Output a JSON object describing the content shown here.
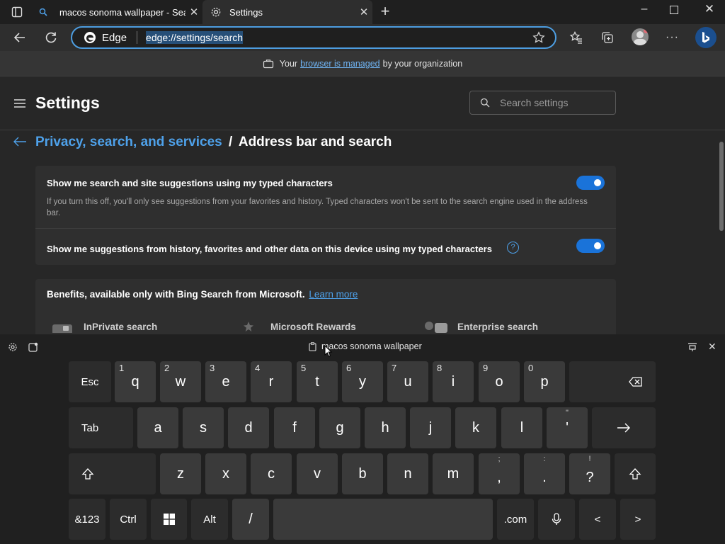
{
  "tabs": [
    {
      "title": "macos sonoma wallpaper - Search",
      "icon": "search-icon"
    },
    {
      "title": "Settings",
      "icon": "gear-icon"
    }
  ],
  "toolbar": {
    "browser_label": "Edge",
    "url": "edge://settings/search"
  },
  "info_bar": {
    "prefix": "Your",
    "link": "browser is managed",
    "suffix": "by your organization"
  },
  "settings": {
    "title": "Settings",
    "search_placeholder": "Search settings",
    "breadcrumb_parent": "Privacy, search, and services",
    "breadcrumb_separator": "/",
    "breadcrumb_current": "Address bar and search",
    "rows": [
      {
        "title": "Show me search and site suggestions using my typed characters",
        "description": "If you turn this off, you'll only see suggestions from your favorites and history. Typed characters won't be sent to the search engine used in the address bar.",
        "toggle": true
      },
      {
        "title": "Show me suggestions from history, favorites and other data on this device using my typed characters",
        "toggle": true
      }
    ],
    "benefits": {
      "title": "Benefits, available only with Bing Search from Microsoft.",
      "link": "Learn more",
      "items": [
        "InPrivate search",
        "Microsoft Rewards",
        "Enterprise search"
      ]
    }
  },
  "keyboard": {
    "clipboard_suggestion": "macos sonoma wallpaper",
    "row1": [
      {
        "label": "Esc"
      },
      {
        "label": "q",
        "num": "1"
      },
      {
        "label": "w",
        "num": "2"
      },
      {
        "label": "e",
        "num": "3"
      },
      {
        "label": "r",
        "num": "4"
      },
      {
        "label": "t",
        "num": "5"
      },
      {
        "label": "y",
        "num": "6"
      },
      {
        "label": "u",
        "num": "7"
      },
      {
        "label": "i",
        "num": "8"
      },
      {
        "label": "o",
        "num": "9"
      },
      {
        "label": "p",
        "num": "0"
      }
    ],
    "row2": [
      {
        "label": "Tab"
      },
      {
        "label": "a"
      },
      {
        "label": "s"
      },
      {
        "label": "d"
      },
      {
        "label": "f"
      },
      {
        "label": "g"
      },
      {
        "label": "h"
      },
      {
        "label": "j"
      },
      {
        "label": "k"
      },
      {
        "label": "l"
      },
      {
        "label": "'",
        "sub": "\""
      }
    ],
    "row3": [
      {
        "label": "z"
      },
      {
        "label": "x"
      },
      {
        "label": "c"
      },
      {
        "label": "v"
      },
      {
        "label": "b"
      },
      {
        "label": "n"
      },
      {
        "label": "m"
      },
      {
        "label": ",",
        "sub": ";"
      },
      {
        "label": ".",
        "sub": ":"
      },
      {
        "label": "?",
        "sub": "!"
      }
    ],
    "row4": [
      {
        "label": "&123"
      },
      {
        "label": "Ctrl"
      },
      {
        "label": "Alt"
      },
      {
        "label": "/"
      },
      {
        "label": ".com"
      },
      {
        "label": "<"
      },
      {
        "label": ">"
      }
    ]
  },
  "colors": {
    "accent": "#4ea1ea",
    "toggle_on": "#1a73d9",
    "background": "#202020"
  }
}
